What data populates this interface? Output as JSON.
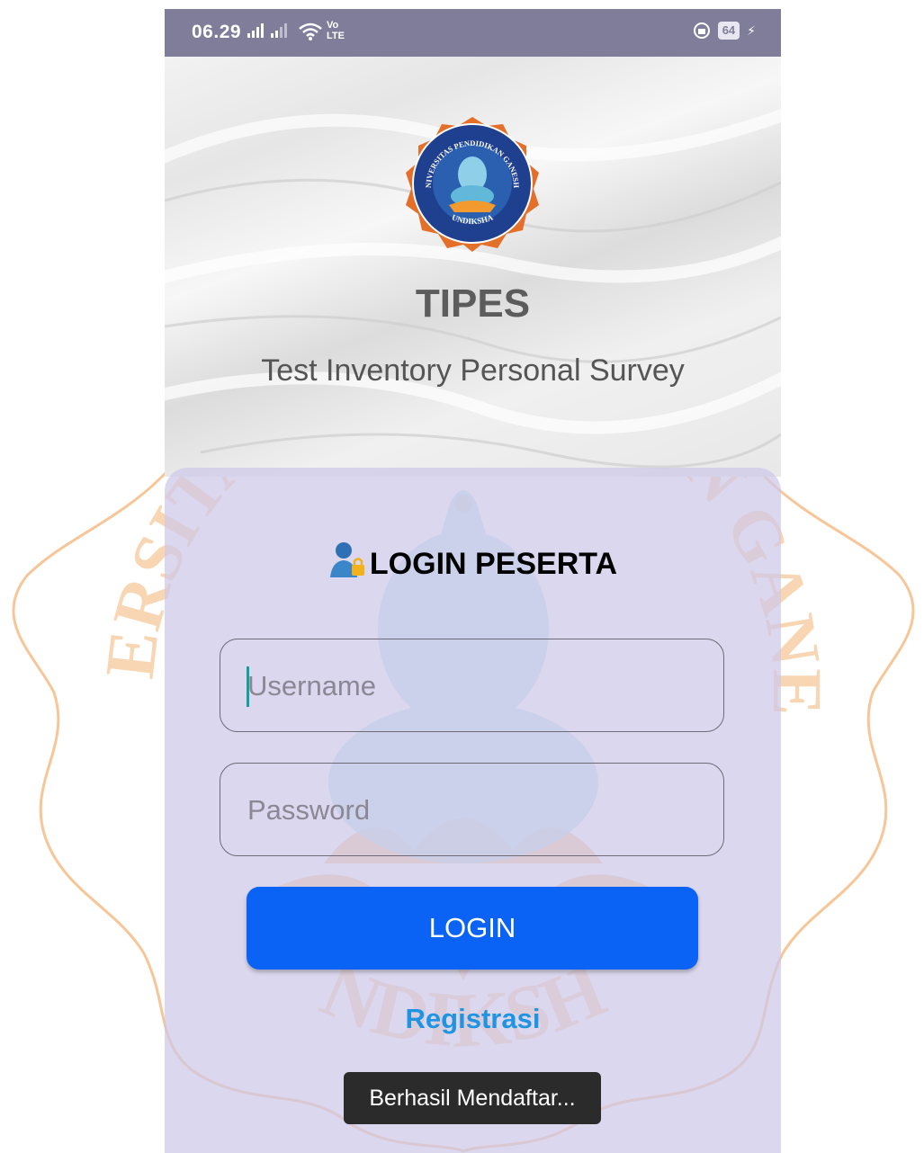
{
  "status_bar": {
    "time": "06.29",
    "network": "Vo LTE",
    "battery": "64"
  },
  "header": {
    "logo_name": "UNIVERSITAS PENDIDIKAN GANESHA",
    "logo_motto": "UNDIKSHA",
    "title": "TIPES",
    "subtitle": "Test Inventory Personal Survey"
  },
  "login": {
    "heading": "LOGIN PESERTA",
    "username_placeholder": "Username",
    "password_placeholder": "Password",
    "button_label": "LOGIN",
    "register_label": "Registrasi"
  },
  "toast": {
    "message": "Berhasil Mendaftar..."
  },
  "watermark": {
    "top_text": "UNIVERSITAS PENDIDIKAN GANESHA",
    "bottom_text": "UNDIKSHA"
  },
  "colors": {
    "status_bar": "#807d9a",
    "login_button": "#0b63f6",
    "register_link": "#1e94e3",
    "card_overlay": "#cdc8e8",
    "seal_orange": "#f3a65a"
  }
}
